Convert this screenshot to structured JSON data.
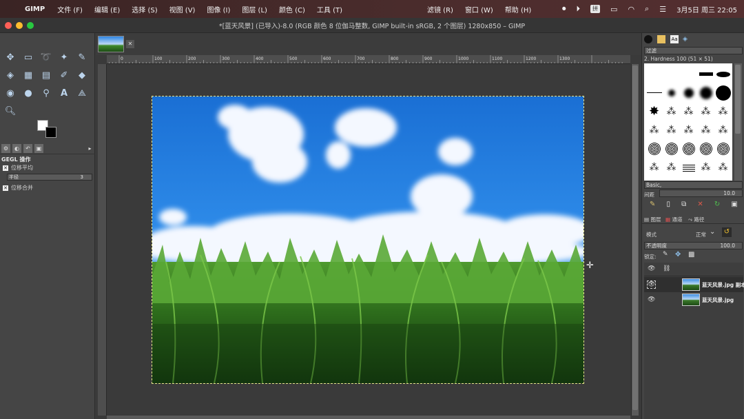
{
  "menubar": {
    "app": "GIMP",
    "items": [
      "文件 (F)",
      "编辑 (E)",
      "选择 (S)",
      "视图 (V)",
      "图像 (I)",
      "图层 (L)",
      "颜色 (C)",
      "工具 (T)"
    ],
    "right_items": [
      "滤镜 (R)",
      "窗口 (W)",
      "帮助 (H)"
    ],
    "ime": "拼",
    "datetime": "3月5日 周三  22:05"
  },
  "window": {
    "title": "*[蓝天风景] (已导入)-8.0 (RGB 颜色 8 位伽马整数, GIMP built-in sRGB, 2 个图层) 1280x850 – GIMP"
  },
  "tool_options": {
    "title": "GEGL 操作",
    "opt1": "位移平均",
    "radius_label": "半径",
    "radius_value": "3",
    "opt2": "位移合并"
  },
  "brushes": {
    "filter_placeholder": "过滤",
    "current": "2. Hardness 100 (51 × 51)",
    "preset": "Basic,",
    "spacing_label": "间距",
    "spacing_value": "10.0"
  },
  "layers": {
    "tabs": [
      "图层",
      "通道",
      "路径"
    ],
    "mode_label": "模式",
    "mode_value": "正常",
    "opacity_label": "不透明度",
    "opacity_value": "100.0",
    "lock_label": "锁定:",
    "items": [
      {
        "name": "蓝天风景.jpg 副本"
      },
      {
        "name": "蓝天风景.jpg"
      }
    ]
  },
  "ruler_labels": [
    "100",
    "0",
    "100",
    "200",
    "300",
    "400",
    "500",
    "600",
    "700",
    "800",
    "900",
    "1000",
    "1100",
    "1200",
    "1300"
  ],
  "icons": {
    "accent": "#bcd4ec",
    "selection_outline": "#e6e68a"
  }
}
